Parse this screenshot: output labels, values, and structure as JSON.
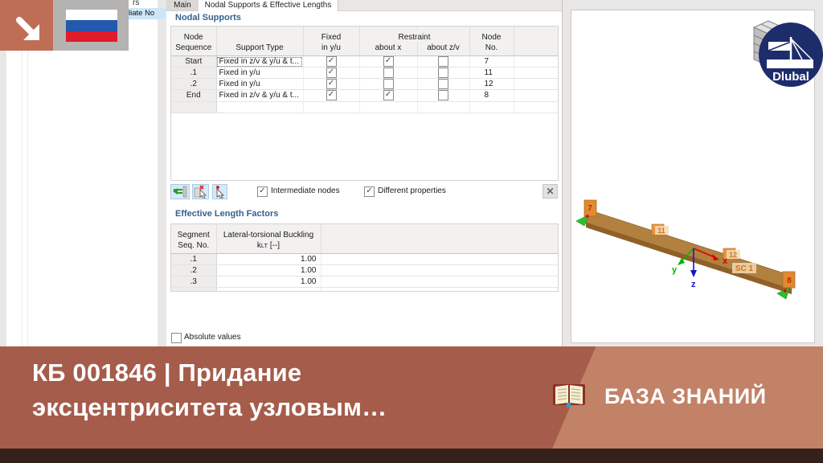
{
  "background_fragments": {
    "top": "rs",
    "highlighted": "liate No"
  },
  "dialog": {
    "tabs": [
      {
        "label": "Main"
      },
      {
        "label": "Nodal Supports & Effective Lengths"
      }
    ],
    "nodal_supports": {
      "title": "Nodal Supports",
      "header": {
        "node": "Node",
        "sequence": "Sequence",
        "support_type": "Support Type",
        "fixed": "Fixed",
        "in_yu": "in y/u",
        "restraint": "Restraint",
        "about_x": "about x",
        "about_zv": "about z/v",
        "node2": "Node",
        "no": "No."
      },
      "rows": [
        {
          "seq": "Start",
          "type": "Fixed in z/v & y/u & t...",
          "fixed_yu": "✓",
          "about_x": "✓",
          "about_zv": "",
          "no": "7"
        },
        {
          "seq": ".1",
          "type": "Fixed in y/u",
          "fixed_yu": "✓",
          "about_x": "",
          "about_zv": "",
          "no": "11"
        },
        {
          "seq": ".2",
          "type": "Fixed in y/u",
          "fixed_yu": "✓",
          "about_x": "",
          "about_zv": "",
          "no": "12"
        },
        {
          "seq": "End",
          "type": "Fixed in z/v & y/u & t...",
          "fixed_yu": "✓",
          "about_x": "✓",
          "about_zv": "",
          "no": "8"
        }
      ],
      "toolbar": {
        "intermediate_nodes_label": "Intermediate nodes",
        "intermediate_nodes_check": "✓",
        "different_properties_label": "Different properties",
        "different_properties_check": "✓",
        "close_icon": "✕"
      }
    },
    "effective_lengths": {
      "title": "Effective Length Factors",
      "header": {
        "segment": "Segment",
        "seq_no": "Seq. No.",
        "ltb": "Lateral-torsional Buckling",
        "k": "k",
        "lt": "LT",
        "unit": " [--]"
      },
      "rows": [
        {
          "seq": ".1",
          "klt": "1.00"
        },
        {
          "seq": ".2",
          "klt": "1.00"
        },
        {
          "seq": ".3",
          "klt": "1.00"
        }
      ]
    },
    "absolute_values_label": "Absolute values",
    "absolute_values_check": ""
  },
  "viewport": {
    "node_start": "7",
    "node_mid1": "11",
    "node_mid2": "12",
    "node_end": "8",
    "sc_label": "SC 1",
    "axes": {
      "x": "x",
      "y": "y",
      "z": "z"
    }
  },
  "logo": {
    "brand": "Dlubal"
  },
  "banner": {
    "title_line1": "КБ 001846 | Придание",
    "title_line2": "эксцентриситета узловым…",
    "kb_label": "БАЗА ЗНАНИЙ",
    "colors": {
      "left": "#A55C4A",
      "right": "#C28267",
      "strip": "#35211B",
      "accent_blue": "#36618F",
      "dlubal_navy": "#1D2C6B"
    }
  }
}
